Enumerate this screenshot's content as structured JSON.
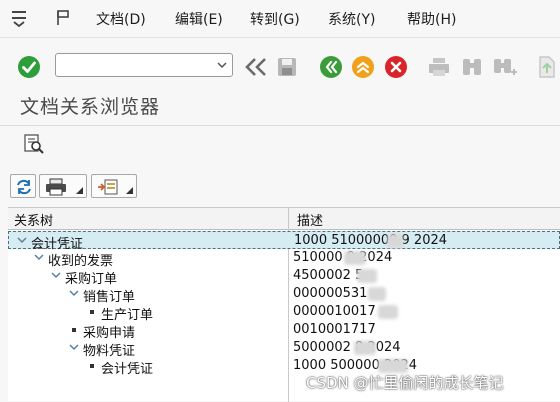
{
  "menu": {
    "items": [
      "文档(D)",
      "编辑(E)",
      "转到(G)",
      "系统(Y)",
      "帮助(H)"
    ]
  },
  "toolbar": {
    "command_value": "",
    "icons": [
      "enter-icon",
      "history-dropdown-icon",
      "back-double-chevron-icon",
      "save-icon",
      "back-icon",
      "exit-icon",
      "cancel-icon",
      "print-icon",
      "find-icon",
      "find-next-icon",
      "first-page-icon"
    ]
  },
  "page": {
    "title": "文档关系浏览器"
  },
  "table": {
    "headers": {
      "tree": "关系树",
      "desc": "描述"
    },
    "rows": [
      {
        "label": "会计凭证",
        "level": 0,
        "node": "expanded",
        "desc": "1000 51000000  9 2024",
        "selected": true
      },
      {
        "label": "收到的发票",
        "level": 1,
        "node": "expanded",
        "desc": "510000    9 2024",
        "selected": false
      },
      {
        "label": "采购订单",
        "level": 2,
        "node": "expanded",
        "desc": "4500002   5",
        "selected": false
      },
      {
        "label": "销售订单",
        "level": 3,
        "node": "expanded",
        "desc": "000000531",
        "selected": false
      },
      {
        "label": "生产订单",
        "level": 4,
        "node": "leaf",
        "desc": "0000010017",
        "selected": false
      },
      {
        "label": "采购申请",
        "level": 3,
        "node": "leaf",
        "desc": "0010001717",
        "selected": false
      },
      {
        "label": "物料凭证",
        "level": 3,
        "node": "expanded",
        "desc": "5000002   8 2024",
        "selected": false
      },
      {
        "label": "会计凭证",
        "level": 4,
        "node": "leaf",
        "desc": "1000 500000      2024",
        "selected": false
      }
    ]
  },
  "watermark": "CSDN @忙里偷闲的成长笔记",
  "colors": {
    "enter_green": "#2e9e3a",
    "nav_green": "#3a9d3a",
    "exit_orange": "#f0a11b",
    "cancel_red": "#d9252a",
    "selection_bg": "#d6ecf3",
    "tree_arrow": "#5a7fa0"
  }
}
